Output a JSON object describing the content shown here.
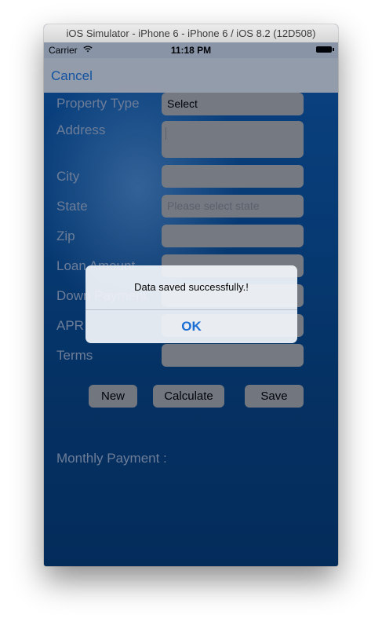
{
  "window": {
    "title": "iOS Simulator - iPhone 6 - iPhone 6 / iOS 8.2 (12D508)"
  },
  "status_bar": {
    "carrier": "Carrier",
    "time": "11:18 PM"
  },
  "nav": {
    "cancel_label": "Cancel"
  },
  "form": {
    "property_type": {
      "label": "Property Type",
      "value": "Select"
    },
    "address": {
      "label": "Address",
      "value": ""
    },
    "city": {
      "label": "City",
      "value": ""
    },
    "state": {
      "label": "State",
      "placeholder": "Please select state"
    },
    "zip": {
      "label": "Zip",
      "value": ""
    },
    "loan_amount": {
      "label": "Loan Amount",
      "value": ""
    },
    "down_payment": {
      "label": "Down Payment",
      "value": ""
    },
    "apr": {
      "label": "APR",
      "value": ""
    },
    "terms": {
      "label": "Terms",
      "value": ""
    }
  },
  "buttons": {
    "new": "New",
    "calculate": "Calculate",
    "save": "Save"
  },
  "result": {
    "monthly_payment_label": "Monthly Payment :"
  },
  "alert": {
    "message": "Data saved successfully.!",
    "ok_label": "OK"
  },
  "colors": {
    "accent": "#1a6ed3",
    "background": "#0a4d96",
    "field": "#a1a4aa",
    "label": "#97a9c8"
  }
}
